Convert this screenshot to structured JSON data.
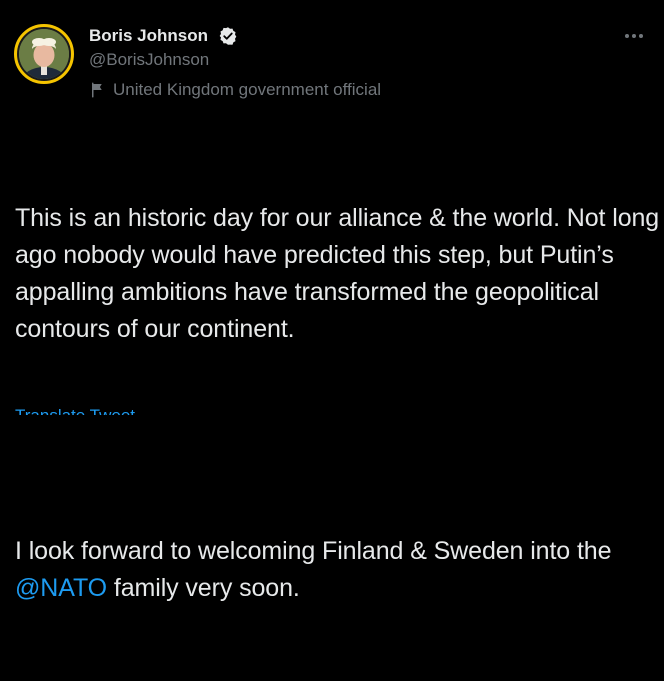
{
  "author": {
    "name": "Boris Johnson",
    "handle": "@BorisJohnson",
    "verified": true,
    "label": "United Kingdom government official"
  },
  "tweet": {
    "paragraph1": "This is an historic day for our alliance & the world. Not long ago nobody would have predicted this step, but Putin’s appalling ambitions have transformed the geopolitical contours of our continent.",
    "paragraph2_before": "I look forward to welcoming Finland & Sweden into the ",
    "mention": "@NATO",
    "paragraph2_after": " family very soon.",
    "cut_off_line": "Translate Tweet"
  },
  "icons": {
    "verified": "verified-badge-icon",
    "label": "flag-icon",
    "menu": "more-options-icon"
  },
  "colors": {
    "background": "#000000",
    "text": "#e7e9ea",
    "secondary": "#71767b",
    "link": "#1d9bf0",
    "avatar_ring": "#f5c400"
  }
}
